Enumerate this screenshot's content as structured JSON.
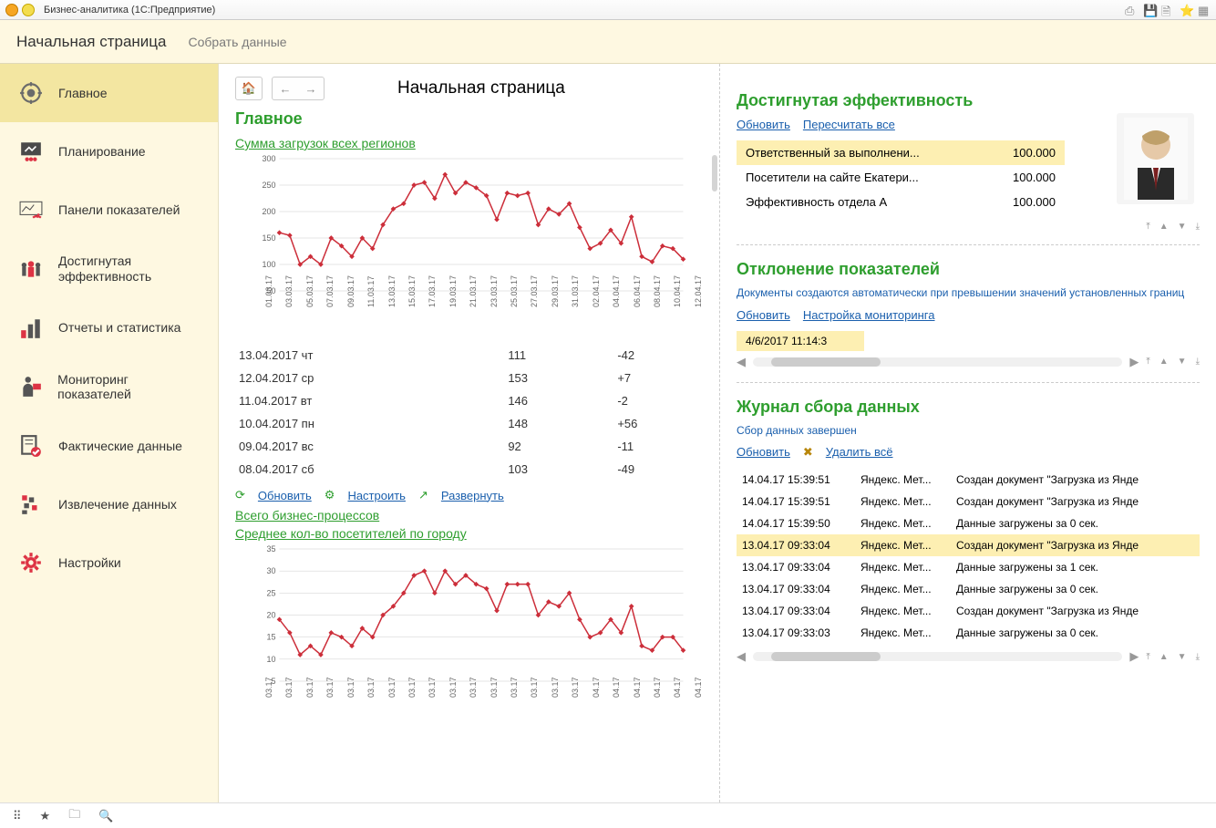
{
  "titlebar": {
    "title": "Бизнес-аналитика  (1С:Предприятие)"
  },
  "header": {
    "active": "Начальная страница",
    "link": "Собрать данные"
  },
  "sidebar": {
    "items": [
      {
        "label": "Главное"
      },
      {
        "label": "Планирование"
      },
      {
        "label": "Панели показателей"
      },
      {
        "label": "Достигнутая\nэффективность"
      },
      {
        "label": "Отчеты и статистика"
      },
      {
        "label": "Мониторинг показателей"
      },
      {
        "label": "Фактические данные"
      },
      {
        "label": "Извлечение данных"
      },
      {
        "label": "Настройки"
      }
    ]
  },
  "page": {
    "title": "Начальная страница"
  },
  "main_section": {
    "title": "Главное",
    "chart1_title": "Сумма загрузок всех регионов",
    "actions": {
      "refresh": "Обновить",
      "configure": "Настроить",
      "expand": "Развернуть"
    },
    "link_bp": "Всего бизнес-процессов",
    "chart2_title": "Среднее кол-во посетителей по городу"
  },
  "chart_data": [
    {
      "type": "line",
      "title": "Сумма загрузок всех регионов",
      "x": [
        "01.03.17",
        "03.03.17",
        "05.03.17",
        "07.03.17",
        "09.03.17",
        "11.03.17",
        "13.03.17",
        "15.03.17",
        "17.03.17",
        "19.03.17",
        "21.03.17",
        "23.03.17",
        "25.03.17",
        "27.03.17",
        "29.03.17",
        "31.03.17",
        "02.04.17",
        "04.04.17",
        "06.04.17",
        "08.04.17",
        "10.04.17",
        "12.04.17"
      ],
      "values": [
        160,
        155,
        100,
        115,
        100,
        150,
        135,
        115,
        150,
        130,
        175,
        205,
        215,
        250,
        255,
        225,
        270,
        235,
        255,
        245,
        230,
        185,
        235,
        230,
        235,
        175,
        205,
        195,
        215,
        170,
        130,
        140,
        165,
        140,
        190,
        115,
        105,
        135,
        130,
        110
      ],
      "ylim": [
        50,
        300
      ],
      "yticks": [
        50,
        100,
        150,
        200,
        250,
        300
      ]
    },
    {
      "type": "line",
      "title": "Среднее кол-во посетителей по городу",
      "x": [
        "03.17",
        "03.17",
        "03.17",
        "03.17",
        "03.17",
        "03.17",
        "03.17",
        "03.17",
        "03.17",
        "03.17",
        "03.17",
        "03.17",
        "03.17",
        "03.17",
        "03.17",
        "03.17",
        "04.17",
        "04.17",
        "04.17",
        "04.17",
        "04.17",
        "04.17"
      ],
      "values": [
        19,
        16,
        11,
        13,
        11,
        16,
        15,
        13,
        17,
        15,
        20,
        22,
        25,
        29,
        30,
        25,
        30,
        27,
        29,
        27,
        26,
        21,
        27,
        27,
        27,
        20,
        23,
        22,
        25,
        19,
        15,
        16,
        19,
        16,
        22,
        13,
        12,
        15,
        15,
        12
      ],
      "ylim": [
        5,
        35
      ],
      "yticks": [
        5,
        10,
        15,
        20,
        25,
        30,
        35
      ]
    }
  ],
  "summary_table": {
    "rows": [
      {
        "date": "13.04.2017 чт",
        "val": "111",
        "delta": "-42"
      },
      {
        "date": "12.04.2017 ср",
        "val": "153",
        "delta": "+7"
      },
      {
        "date": "11.04.2017 вт",
        "val": "146",
        "delta": "-2"
      },
      {
        "date": "10.04.2017 пн",
        "val": "148",
        "delta": "+56"
      },
      {
        "date": "09.04.2017 вс",
        "val": "92",
        "delta": "-11"
      },
      {
        "date": "08.04.2017 сб",
        "val": "103",
        "delta": "-49"
      }
    ]
  },
  "effectiveness": {
    "title": "Достигнутая эффективность",
    "links": {
      "refresh": "Обновить",
      "recalc": "Пересчитать все"
    },
    "rows": [
      {
        "label": "Ответственный за выполнени...",
        "val": "100.000",
        "hl": true
      },
      {
        "label": "Посетители на сайте Екатери...",
        "val": "100.000",
        "hl": false
      },
      {
        "label": "Эффективность отдела А",
        "val": "100.000",
        "hl": false
      }
    ]
  },
  "deviation": {
    "title": "Отклонение показателей",
    "desc": "Документы создаются автоматически при превышении значений установленных границ",
    "links": {
      "refresh": "Обновить",
      "settings": "Настройка мониторинга"
    },
    "row_peek": "4/6/2017 11:14:3"
  },
  "journal": {
    "title": "Журнал сбора данных",
    "status": "Сбор данных завершен",
    "links": {
      "refresh": "Обновить",
      "delete": "Удалить всё"
    },
    "rows": [
      {
        "t": "14.04.17 15:39:51",
        "src": "Яндекс. Мет...",
        "msg": "Создан документ \"Загрузка из Янде",
        "hl": false
      },
      {
        "t": "14.04.17 15:39:51",
        "src": "Яндекс. Мет...",
        "msg": "Создан документ \"Загрузка из Янде",
        "hl": false
      },
      {
        "t": "14.04.17 15:39:50",
        "src": "Яндекс. Мет...",
        "msg": "Данные загружены за 0 сек.",
        "hl": false
      },
      {
        "t": "13.04.17 09:33:04",
        "src": "Яндекс. Мет...",
        "msg": "Создан документ \"Загрузка из Янде",
        "hl": true
      },
      {
        "t": "13.04.17 09:33:04",
        "src": "Яндекс. Мет...",
        "msg": "Данные загружены за 1 сек.",
        "hl": false
      },
      {
        "t": "13.04.17 09:33:04",
        "src": "Яндекс. Мет...",
        "msg": "Данные загружены за 0 сек.",
        "hl": false
      },
      {
        "t": "13.04.17 09:33:04",
        "src": "Яндекс. Мет...",
        "msg": "Создан документ \"Загрузка из Янде",
        "hl": false
      },
      {
        "t": "13.04.17 09:33:03",
        "src": "Яндекс. Мет...",
        "msg": "Данные загружены за 0 сек.",
        "hl": false
      }
    ]
  }
}
